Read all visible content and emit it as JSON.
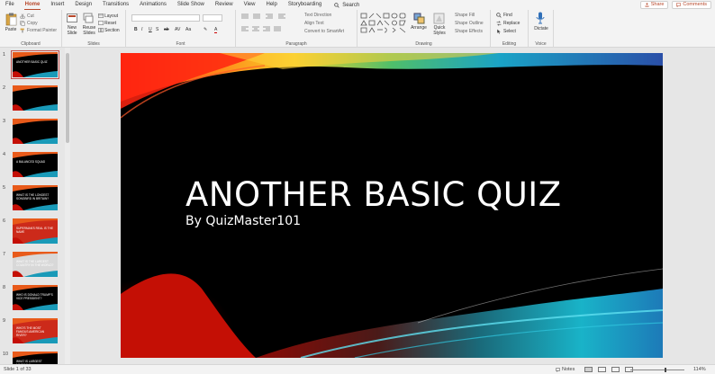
{
  "tabs": [
    "File",
    "Home",
    "Insert",
    "Design",
    "Transitions",
    "Animations",
    "Slide Show",
    "Review",
    "View",
    "Help",
    "Storyboarding"
  ],
  "active_tab": "Home",
  "search": {
    "label": "Search"
  },
  "share_label": "Share",
  "comments_label": "Comments",
  "ribbon": {
    "clipboard": {
      "label": "Clipboard",
      "paste": "Paste",
      "cut": "Cut",
      "copy": "Copy",
      "format_painter": "Format Painter"
    },
    "slides": {
      "label": "Slides",
      "new_slide": "New Slide",
      "reuse_slides": "Reuse Slides",
      "layout": "Layout",
      "reset": "Reset",
      "section": "Section"
    },
    "font": {
      "label": "Font"
    },
    "paragraph": {
      "label": "Paragraph",
      "text_direction": "Text Direction",
      "align_text": "Align Text",
      "convert_smartart": "Convert to SmartArt"
    },
    "drawing": {
      "label": "Drawing",
      "arrange": "Arrange",
      "quick_styles": "Quick Styles",
      "shape_fill": "Shape Fill",
      "shape_outline": "Shape Outline",
      "shape_effects": "Shape Effects"
    },
    "editing": {
      "label": "Editing",
      "find": "Find",
      "replace": "Replace",
      "select": "Select"
    },
    "voice": {
      "label": "Voice",
      "dictate": "Dictate"
    }
  },
  "thumbnails": [
    {
      "num": "1",
      "text": "ANOTHER BASIC QUIZ",
      "bg": "#000000"
    },
    {
      "num": "2",
      "text": "",
      "bg": "#000000"
    },
    {
      "num": "3",
      "text": "",
      "bg": "#000000"
    },
    {
      "num": "4",
      "text": "A BALANCED SQUAD",
      "bg": "#000000"
    },
    {
      "num": "5",
      "text": "WHAT IS THE LONGEST SONGBIRD IN BRITAIN?",
      "bg": "#000000"
    },
    {
      "num": "6",
      "text": "SUPERMAN'S REAL IS THE NAME",
      "bg": "#cc2a1a"
    },
    {
      "num": "7",
      "text": "WHAT IS THE LARGEST COUNTRY IN THE WORLD?",
      "bg": "#d8d8d8"
    },
    {
      "num": "8",
      "text": "WHO IS DONALD TRUMP'S VICE PRESIDENT?",
      "bg": "#000000"
    },
    {
      "num": "9",
      "text": "WHO'S THE MOST FAMOUS AMERICAN RIVER?",
      "bg": "#cc2a1a"
    },
    {
      "num": "10",
      "text": "WHAT IS LARGEST MAMMAL?",
      "bg": "#000000"
    }
  ],
  "slide": {
    "title": "ANOTHER BASIC QUIZ",
    "subtitle": "By QuizMaster101"
  },
  "status": {
    "slide_counter": "Slide 1 of 33",
    "notes": "Notes",
    "zoom": "114%"
  }
}
